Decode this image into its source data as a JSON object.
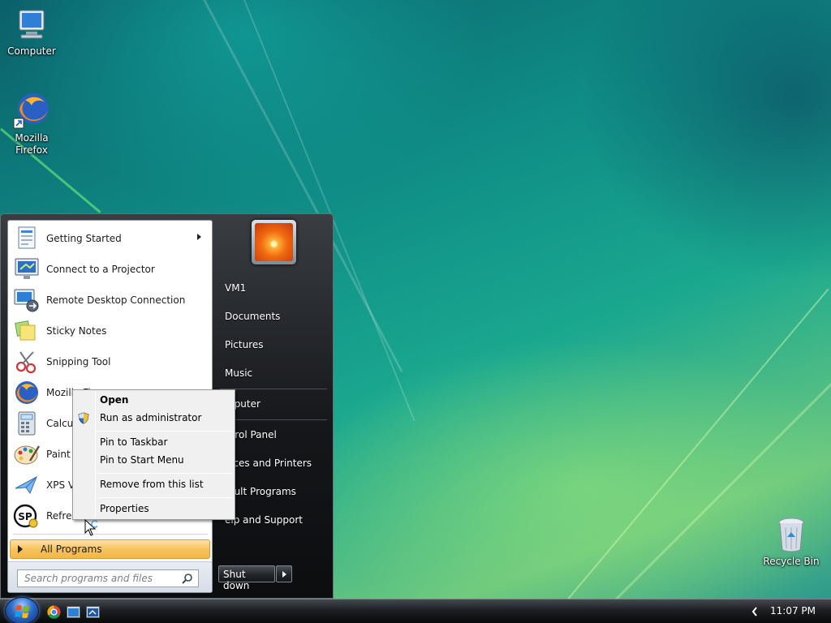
{
  "desktop": {
    "icons": [
      {
        "label": "Computer"
      },
      {
        "label": "Mozilla Firefox"
      },
      {
        "label": "Recycle Bin"
      }
    ]
  },
  "start_menu": {
    "programs": [
      {
        "label": "Getting Started",
        "icon": "getting-started-icon",
        "has_submenu": true
      },
      {
        "label": "Connect to a Projector",
        "icon": "projector-icon"
      },
      {
        "label": "Remote Desktop Connection",
        "icon": "remote-desktop-icon"
      },
      {
        "label": "Sticky Notes",
        "icon": "sticky-notes-icon"
      },
      {
        "label": "Snipping Tool",
        "icon": "snipping-tool-icon"
      },
      {
        "label": "Mozilla Fi",
        "icon": "firefox-icon"
      },
      {
        "label": "Calcula",
        "icon": "calculator-icon"
      },
      {
        "label": "Paint",
        "icon": "paint-icon"
      },
      {
        "label": "XPS Vie",
        "icon": "xps-viewer-icon"
      },
      {
        "label": "Refresh",
        "icon": "sp-refresh-icon"
      }
    ],
    "all_programs_label": "All Programs",
    "search_placeholder": "Search programs and files",
    "right_items": [
      {
        "label": "VM1"
      },
      {
        "label": "Documents"
      },
      {
        "label": "Pictures"
      },
      {
        "label": "Music"
      },
      {
        "label": "mputer"
      },
      {
        "label": "ntrol Panel"
      },
      {
        "label": "vices and Printers"
      },
      {
        "label": "fault Programs"
      },
      {
        "label": "elp and Support"
      }
    ],
    "shutdown_label": "Shut down"
  },
  "context_menu": {
    "items": [
      {
        "label": "Open",
        "bold": true
      },
      {
        "label": "Run as administrator",
        "icon": "uac-shield-icon"
      },
      {
        "label": "Pin to Taskbar"
      },
      {
        "label": "Pin to Start Menu"
      },
      {
        "label": "Remove from this list"
      },
      {
        "label": "Properties"
      }
    ]
  },
  "taskbar": {
    "clock": "11:07 PM",
    "pinned": [
      {
        "icon": "chrome-icon"
      },
      {
        "icon": "explorer-window-icon"
      },
      {
        "icon": "remote-window-icon"
      }
    ]
  },
  "colors": {
    "accent_all_programs": "#f6c35e",
    "menu_dark": "#15171a",
    "desktop_teal": "#0f8d86"
  }
}
